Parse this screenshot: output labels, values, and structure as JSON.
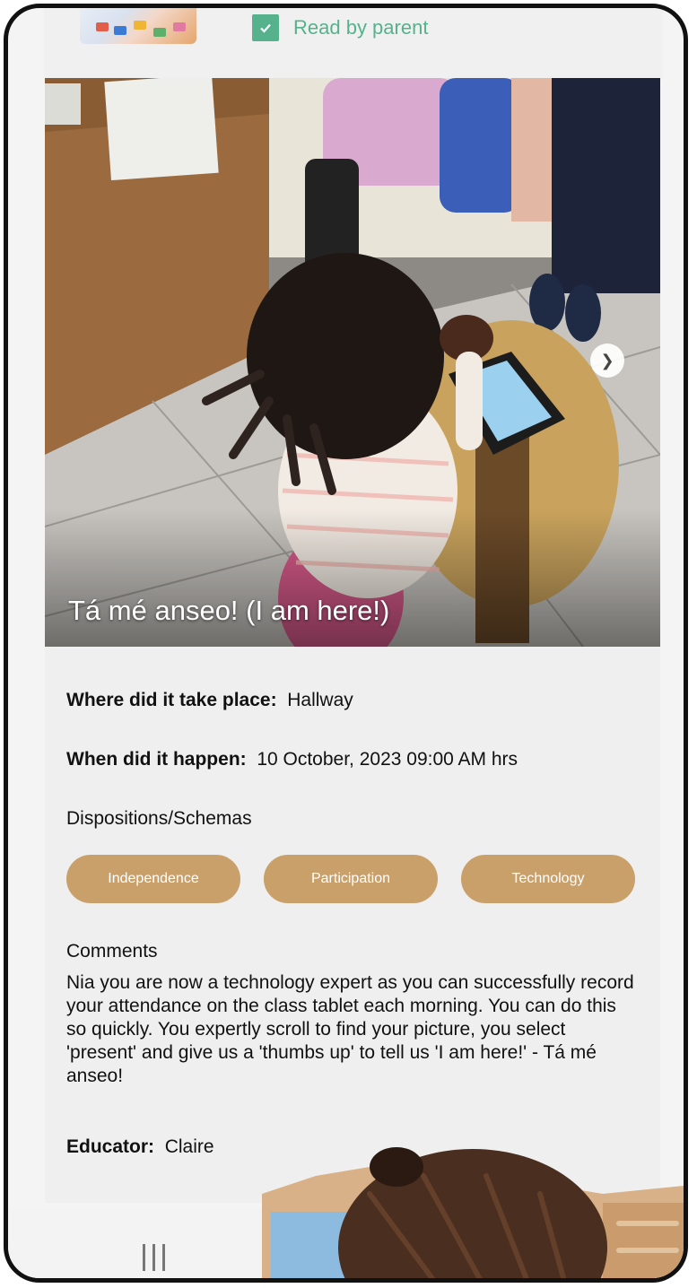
{
  "top_card": {
    "read_status": "Read by parent"
  },
  "photo": {
    "title": "Tá mé anseo! (I am here!)"
  },
  "details": {
    "where_label": "Where did it take place:",
    "where_value": "Hallway",
    "when_label": "When did it happen:",
    "when_value": "10 October, 2023 09:00 AM hrs",
    "dispositions_label": "Dispositions/Schemas",
    "dispositions": [
      "Independence",
      "Participation",
      "Technology"
    ],
    "comments_label": "Comments",
    "comments": "Nia you are now a technology expert as you can successfully record your attendance on the class tablet each morning. You can do this so quickly. You expertly scroll to find your picture, you select 'present' and give us a 'thumbs up' to tell us 'I am here!' - Tá mé anseo!",
    "educator_label": "Educator:",
    "educator_value": "Claire"
  },
  "icons": {
    "check": "check-icon",
    "next": "chevron-right-icon",
    "recents": "recents-icon"
  },
  "colors": {
    "accent_green": "#55b28c",
    "chip": "#c9a06a"
  }
}
